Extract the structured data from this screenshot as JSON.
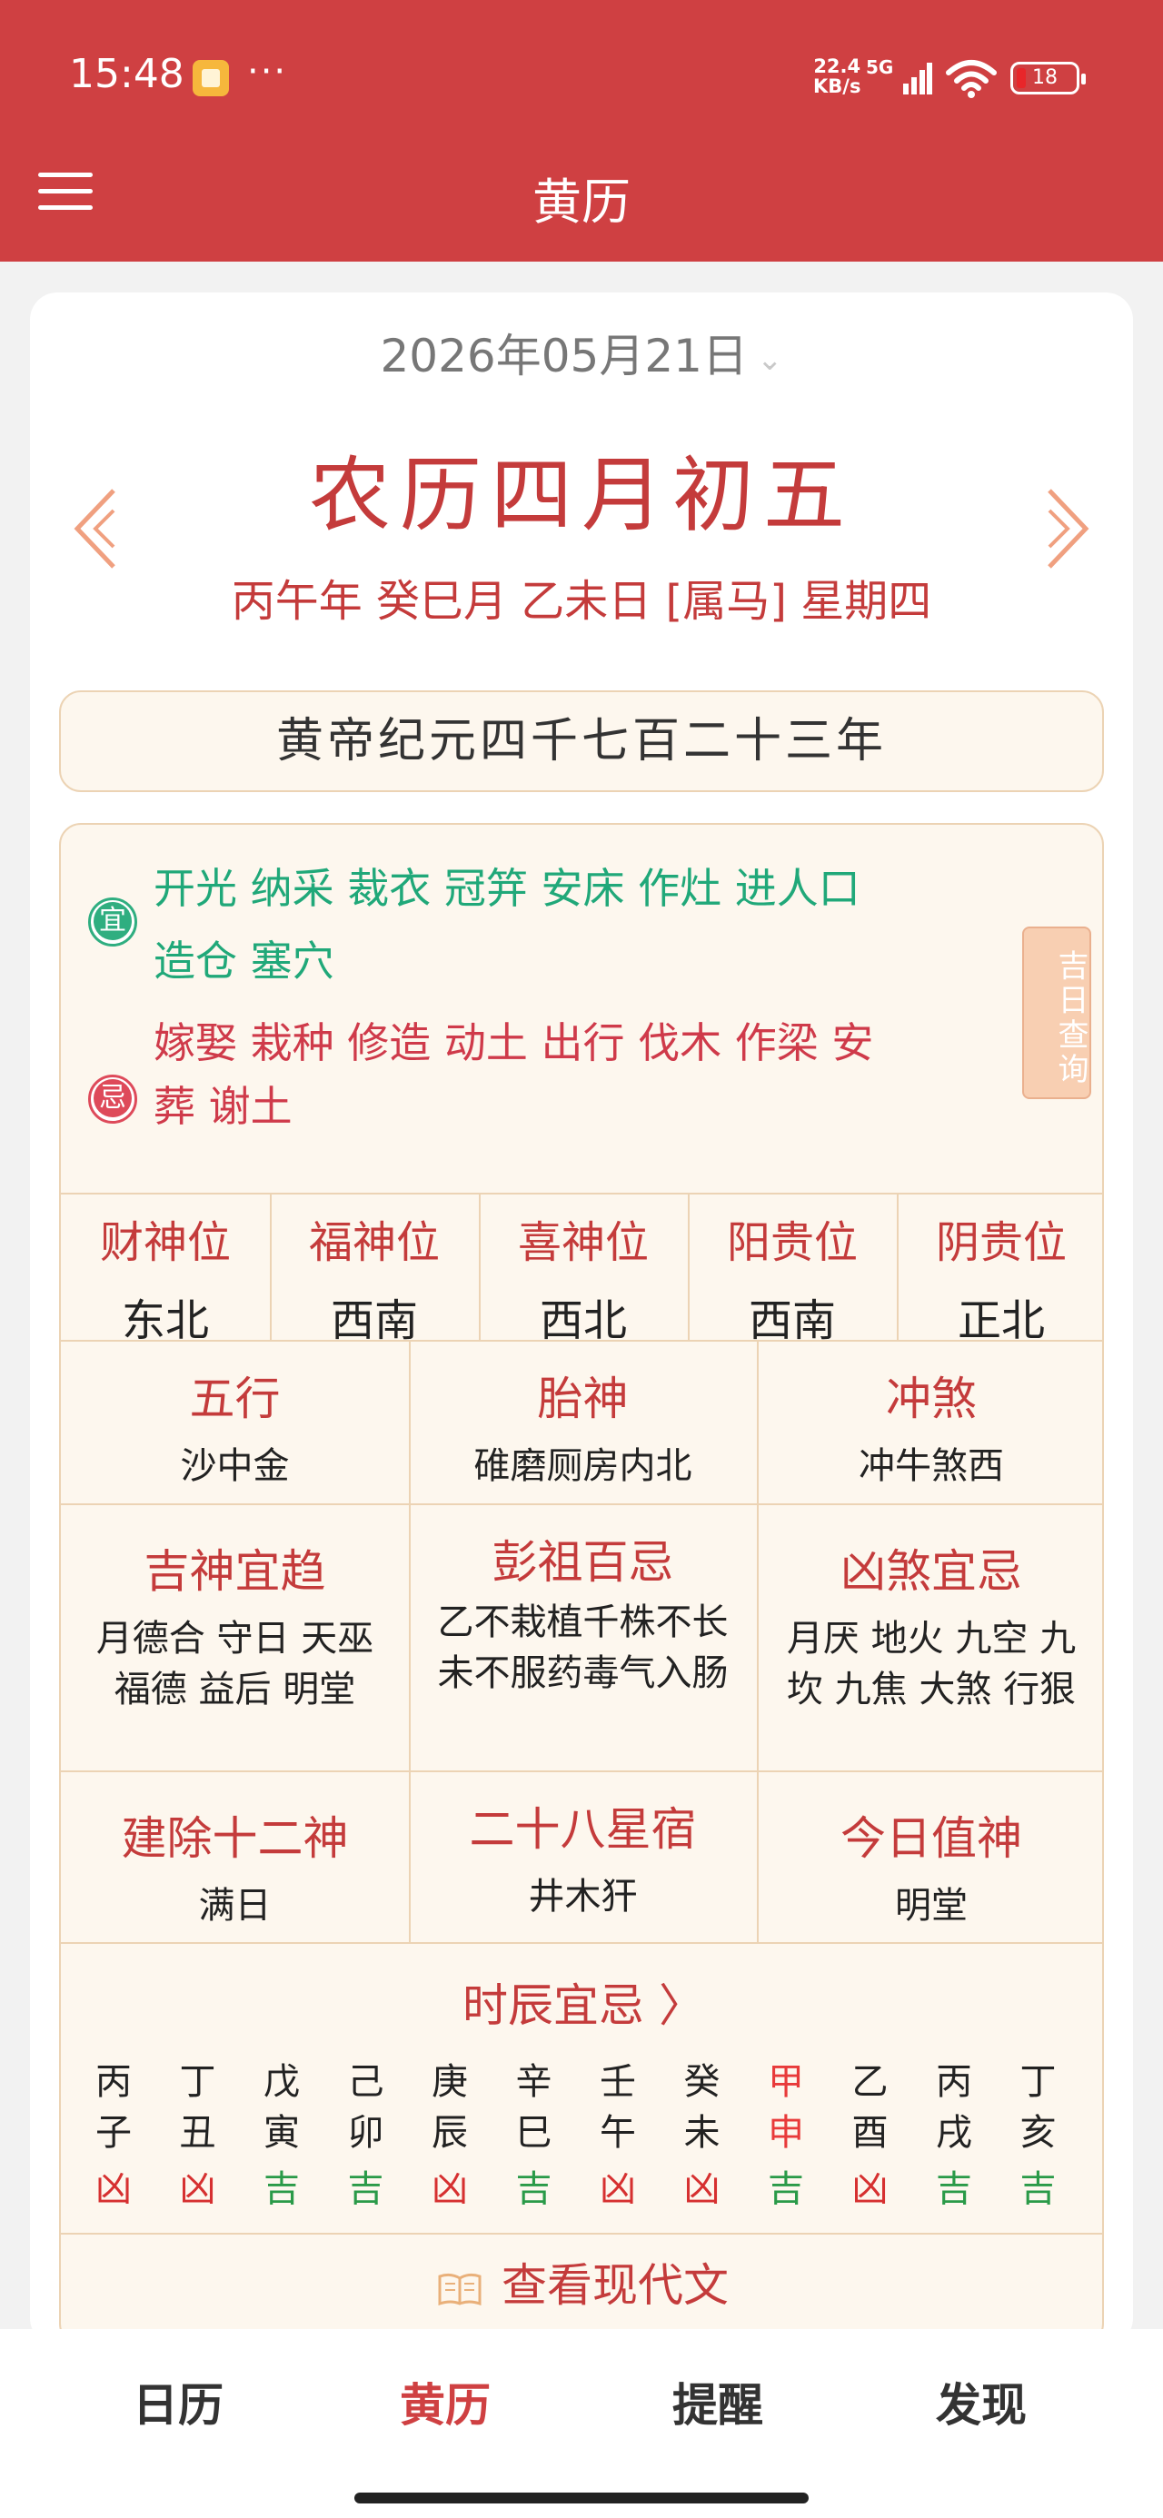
{
  "status_bar": {
    "time": "15:48",
    "dots": "···",
    "speed_top": "22.4",
    "speed_bottom": "KB/s",
    "network": "5G",
    "battery": "18"
  },
  "app_bar": {
    "title": "黄历"
  },
  "date_selector": {
    "date": "2026年05月21日",
    "chevron": "⌄"
  },
  "lunar": {
    "main": "农历四月初五",
    "ganzhi": "丙午年 癸巳月 乙未日 [属马] 星期四"
  },
  "era": "黄帝纪元四千七百二十三年",
  "yi": {
    "badge": "宜",
    "line1": "开光 纳采 裁衣 冠笄 安床 作灶 进人口",
    "line2": "造仓 塞穴"
  },
  "ji": {
    "badge": "忌",
    "line1": "嫁娶 栽种 修造 动土 出行 伐木 作梁 安",
    "line2": "葬 谢土"
  },
  "jiri_button": "吉日查询",
  "gods_positions": [
    {
      "label": "财神位",
      "value": "东北"
    },
    {
      "label": "福神位",
      "value": "西南"
    },
    {
      "label": "喜神位",
      "value": "西北"
    },
    {
      "label": "阳贵位",
      "value": "西南"
    },
    {
      "label": "阴贵位",
      "value": "正北"
    }
  ],
  "row1": [
    {
      "title": "五行",
      "value": "沙中金"
    },
    {
      "title": "胎神",
      "value": "碓磨厕房内北"
    },
    {
      "title": "冲煞",
      "value": "冲牛煞西"
    }
  ],
  "row2": [
    {
      "title": "吉神宜趋",
      "line1": "月德合 守日 天巫",
      "line2": "福德 益后 明堂"
    },
    {
      "title": "彭祖百忌",
      "line1": "乙不栽植千株不长",
      "line2": "未不服药毒气入肠"
    },
    {
      "title": "凶煞宜忌",
      "line1": "月厌 地火 九空 九",
      "line2": "坎 九焦 大煞 行狠"
    }
  ],
  "row3": [
    {
      "title": "建除十二神",
      "value": "满日"
    },
    {
      "title": "二十八星宿",
      "value": "井木犴"
    },
    {
      "title": "今日值神",
      "value": "明堂"
    }
  ],
  "hours": {
    "title": "时辰宜忌 〉",
    "items": [
      {
        "gan": "丙",
        "zhi": "子",
        "luck": "凶",
        "good": false,
        "current": false
      },
      {
        "gan": "丁",
        "zhi": "丑",
        "luck": "凶",
        "good": false,
        "current": false
      },
      {
        "gan": "戊",
        "zhi": "寅",
        "luck": "吉",
        "good": true,
        "current": false
      },
      {
        "gan": "己",
        "zhi": "卯",
        "luck": "吉",
        "good": true,
        "current": false
      },
      {
        "gan": "庚",
        "zhi": "辰",
        "luck": "凶",
        "good": false,
        "current": false
      },
      {
        "gan": "辛",
        "zhi": "巳",
        "luck": "吉",
        "good": true,
        "current": false
      },
      {
        "gan": "壬",
        "zhi": "午",
        "luck": "凶",
        "good": false,
        "current": false
      },
      {
        "gan": "癸",
        "zhi": "未",
        "luck": "凶",
        "good": false,
        "current": false
      },
      {
        "gan": "甲",
        "zhi": "申",
        "luck": "吉",
        "good": true,
        "current": true
      },
      {
        "gan": "乙",
        "zhi": "酉",
        "luck": "凶",
        "good": false,
        "current": false
      },
      {
        "gan": "丙",
        "zhi": "戌",
        "luck": "吉",
        "good": true,
        "current": false
      },
      {
        "gan": "丁",
        "zhi": "亥",
        "luck": "吉",
        "good": true,
        "current": false
      }
    ]
  },
  "modern_text_button": "查看现代文",
  "bottom_nav": [
    {
      "label": "日历",
      "active": false
    },
    {
      "label": "黄历",
      "active": true
    },
    {
      "label": "提醒",
      "active": false
    },
    {
      "label": "发现",
      "active": false
    }
  ],
  "colors": {
    "header": "#cf4042",
    "accent_red": "#c43b3b",
    "yi_green": "#20a879",
    "ji_red": "#cf3a4a",
    "good": "#2a9a48",
    "bad": "#d63030",
    "panel_bg": "#fdf7ee"
  },
  "icons": [
    "menu-icon",
    "chevron-left-icon",
    "chevron-right-icon",
    "book-icon",
    "signal-icon",
    "wifi-icon",
    "battery-icon"
  ]
}
